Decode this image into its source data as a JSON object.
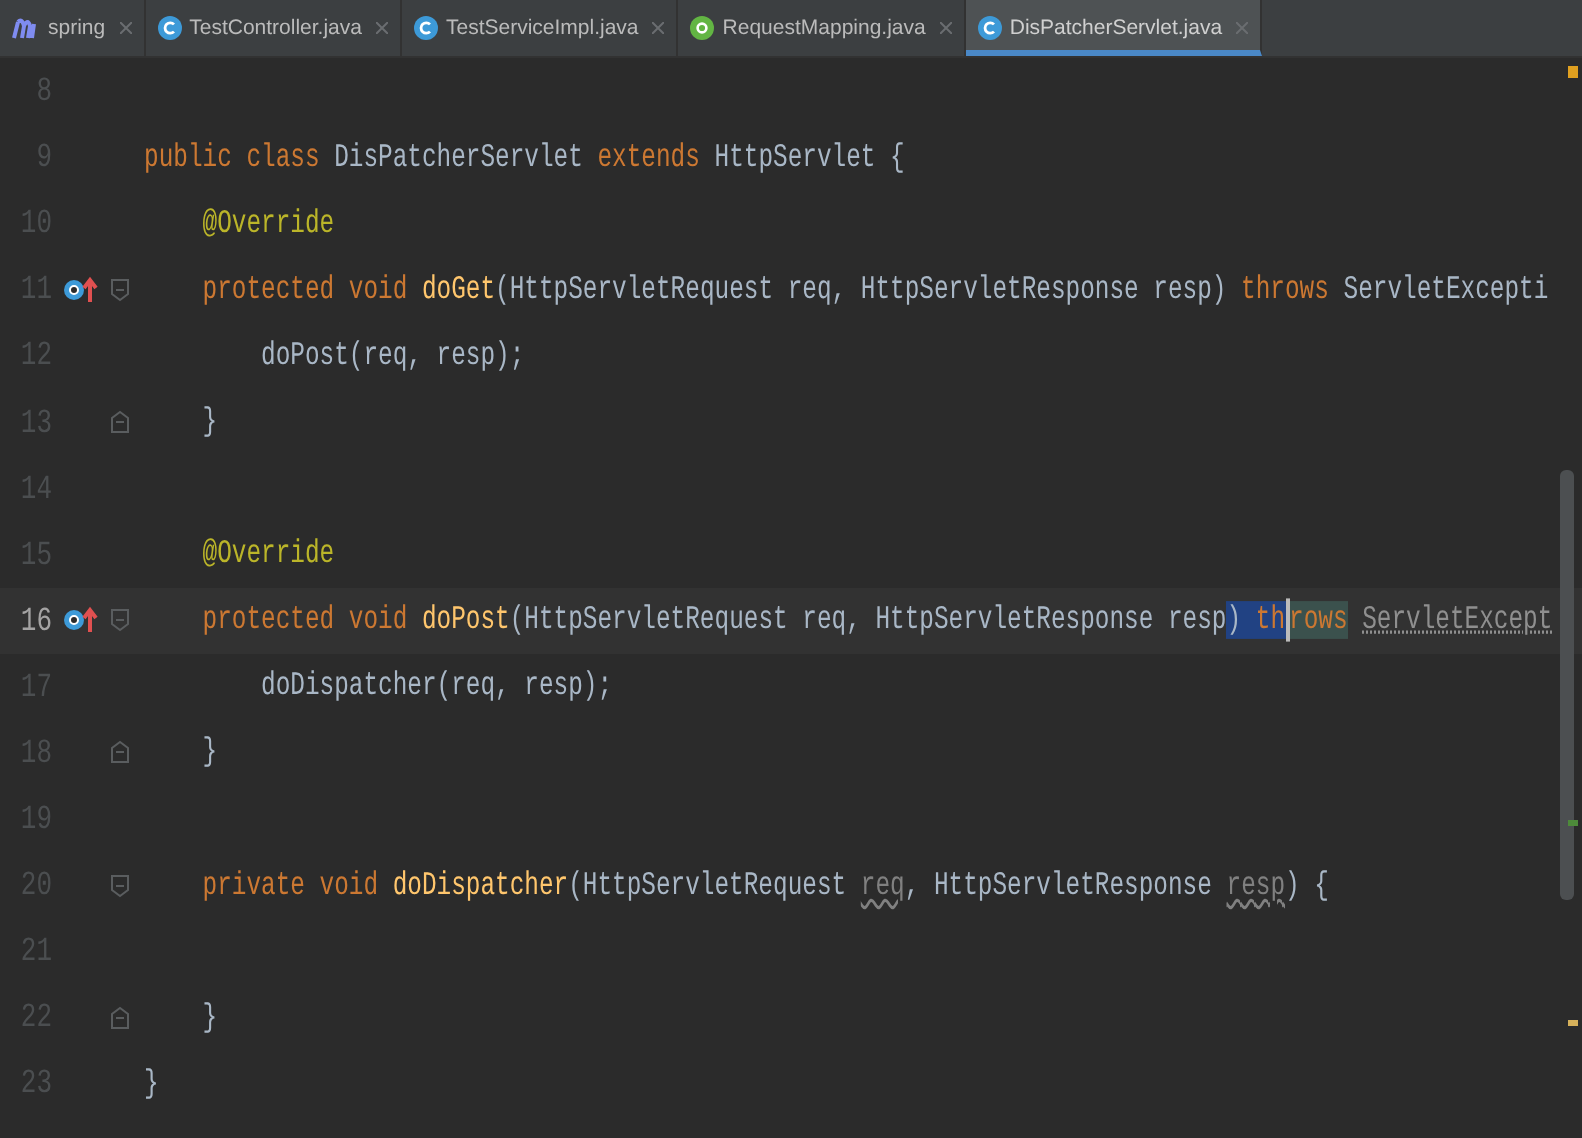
{
  "tabs": [
    {
      "label": "spring",
      "kind": "module",
      "selected": false
    },
    {
      "label": "TestController.java",
      "kind": "class",
      "selected": false
    },
    {
      "label": "TestServiceImpl.java",
      "kind": "class",
      "selected": false
    },
    {
      "label": "RequestMapping.java",
      "kind": "annotation",
      "selected": false
    },
    {
      "label": "DisPatcherServlet.java",
      "kind": "class",
      "selected": true
    }
  ],
  "lines": [
    {
      "number": "8",
      "current": false,
      "overrides": false,
      "fold_open": false,
      "fold_close": false
    },
    {
      "number": "9",
      "current": false,
      "overrides": false,
      "fold_open": false,
      "fold_close": false,
      "tokens": [
        {
          "kind": "keyword",
          "text": "public class "
        },
        {
          "kind": "plain",
          "text": "DisPatcherServlet "
        },
        {
          "kind": "keyword",
          "text": "extends "
        },
        {
          "kind": "plain",
          "text": "HttpServlet {"
        }
      ]
    },
    {
      "number": "10",
      "current": false,
      "overrides": false,
      "fold_open": false,
      "fold_close": false,
      "tokens": [
        {
          "kind": "annotation",
          "text": "    @Override"
        }
      ]
    },
    {
      "number": "11",
      "current": false,
      "overrides": true,
      "fold_open": true,
      "fold_close": false,
      "tokens": [
        {
          "kind": "keyword",
          "text": "    protected void "
        },
        {
          "kind": "method",
          "text": "doGet"
        },
        {
          "kind": "plain",
          "text": "(HttpServletRequest req, HttpServletResponse resp) "
        },
        {
          "kind": "keyword",
          "text": "throws "
        },
        {
          "kind": "plain",
          "text": "ServletExcepti"
        }
      ]
    },
    {
      "number": "12",
      "current": false,
      "overrides": false,
      "fold_open": false,
      "fold_close": false,
      "tokens": [
        {
          "kind": "plain",
          "text": "        doPost(req, resp);"
        }
      ]
    },
    {
      "number": "13",
      "current": false,
      "overrides": false,
      "fold_open": false,
      "fold_close": true,
      "tokens": [
        {
          "kind": "plain",
          "text": "    }"
        }
      ]
    },
    {
      "number": "14",
      "current": false,
      "overrides": false,
      "fold_open": false,
      "fold_close": false
    },
    {
      "number": "15",
      "current": false,
      "overrides": false,
      "fold_open": false,
      "fold_close": false,
      "tokens": [
        {
          "kind": "annotation",
          "text": "    @Override"
        }
      ]
    },
    {
      "number": "16",
      "current": true,
      "overrides": true,
      "fold_open": true,
      "fold_close": false,
      "tokens": [
        {
          "kind": "keyword",
          "text": "    protected void "
        },
        {
          "kind": "method",
          "text": "doPost"
        },
        {
          "kind": "plain",
          "text": "(HttpServletRequest req, HttpServletResponse resp"
        },
        {
          "kind": "selection",
          "text": ") "
        },
        {
          "kind": "selected_keyword",
          "text": "th"
        },
        {
          "kind": "matched_keyword",
          "text": "rows",
          "caret_before": true
        },
        {
          "kind": "dimmed",
          "text": "ServletExcept"
        }
      ]
    },
    {
      "number": "17",
      "current": false,
      "overrides": false,
      "fold_open": false,
      "fold_close": false,
      "tokens": [
        {
          "kind": "plain",
          "text": "        doDispatcher(req, resp);"
        }
      ]
    },
    {
      "number": "18",
      "current": false,
      "overrides": false,
      "fold_open": false,
      "fold_close": true,
      "tokens": [
        {
          "kind": "plain",
          "text": "    }"
        }
      ]
    },
    {
      "number": "19",
      "current": false,
      "overrides": false,
      "fold_open": false,
      "fold_close": false
    },
    {
      "number": "20",
      "current": false,
      "overrides": false,
      "fold_open": true,
      "fold_close": false,
      "tokens": [
        {
          "kind": "keyword",
          "text": "    private void "
        },
        {
          "kind": "method",
          "text": "doDispatcher"
        },
        {
          "kind": "plain",
          "text": "(HttpServletRequest "
        },
        {
          "kind": "unused",
          "text": "req"
        },
        {
          "kind": "plain",
          "text": ", HttpServletResponse "
        },
        {
          "kind": "unused",
          "text": "resp"
        },
        {
          "kind": "plain",
          "text": ") {"
        }
      ]
    },
    {
      "number": "21",
      "current": false,
      "overrides": false,
      "fold_open": false,
      "fold_close": false
    },
    {
      "number": "22",
      "current": false,
      "overrides": false,
      "fold_open": false,
      "fold_close": true,
      "tokens": [
        {
          "kind": "plain",
          "text": "    }"
        }
      ]
    },
    {
      "number": "23",
      "current": false,
      "overrides": false,
      "fold_open": false,
      "fold_close": false,
      "tokens": [
        {
          "kind": "plain",
          "text": "}"
        }
      ]
    }
  ]
}
